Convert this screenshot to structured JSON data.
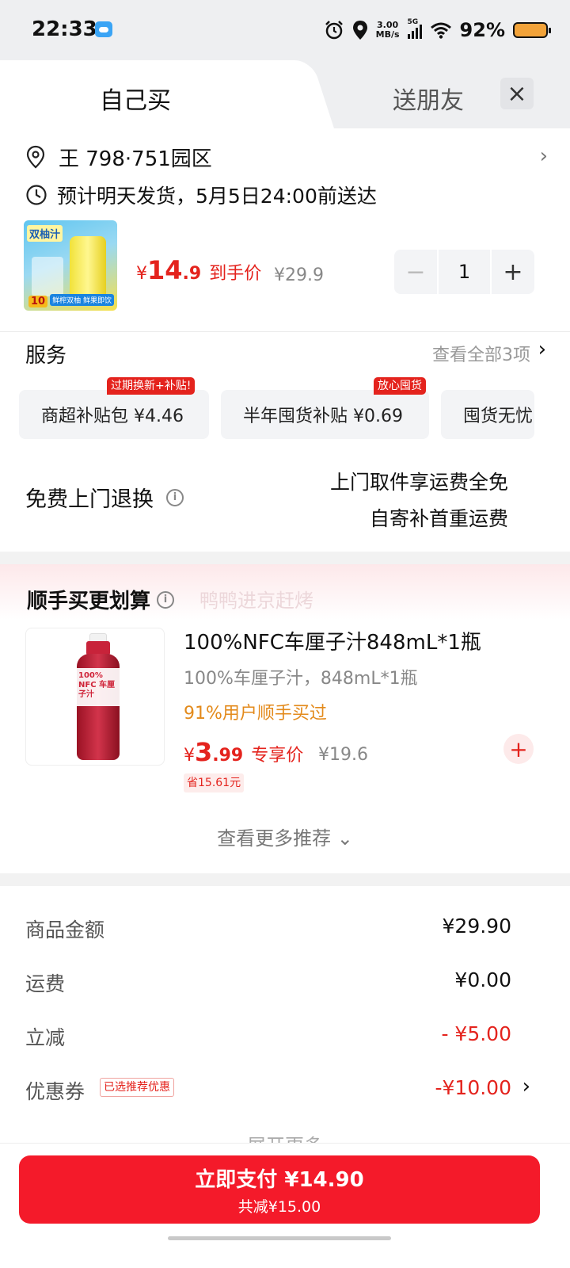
{
  "status_bar": {
    "time": "22:33",
    "net_speed_value": "3.00",
    "net_speed_unit": "MB/s",
    "network": "5G",
    "battery": "92%",
    "icons": [
      "weather-cloud-icon",
      "alarm-icon",
      "location-icon",
      "signal-icon",
      "wifi-icon",
      "battery-icon"
    ]
  },
  "tabs": {
    "self_buy": "自己买",
    "gift": "送朋友",
    "close_icon": "×"
  },
  "address": {
    "text": "王  798·751园区",
    "chevron": "›"
  },
  "shipping": {
    "text": "预计明天发货，5月5日24:00前送达"
  },
  "product": {
    "image_title": "双柚汁",
    "image_badge": "10",
    "image_tag": "鲜榨双柚 鲜果即饮",
    "price_currency": "¥",
    "price_int": "14",
    "price_dec": ".9",
    "price_label": "到手价",
    "original_price": "¥29.9",
    "quantity": "1",
    "minus": "−",
    "plus": "+"
  },
  "service": {
    "title": "服务",
    "view_all": "查看全部3项",
    "chevron": "›",
    "cards": [
      {
        "label": "商超补贴包  ¥4.46",
        "badge": "过期换新+补贴!"
      },
      {
        "label": "半年囤货补贴  ¥0.69",
        "badge": "放心囤货"
      },
      {
        "label": "囤货无忧",
        "badge": ""
      }
    ]
  },
  "free_return": {
    "label": "免费上门退换",
    "info_icon": "i",
    "note_line1": "上门取件享运费全免",
    "note_line2": "自寄补首重运费"
  },
  "recommend": {
    "title": "顺手买更划算",
    "info_icon": "i",
    "watermark": "鸭鸭进京赶烤",
    "item": {
      "bottle_text": "100% NFC 车厘子汁",
      "name": "100%NFC车厘子汁848mL*1瓶",
      "spec": "100%车厘子汁，848mL*1瓶",
      "bought": "91%用户顺手买过",
      "price_currency": "¥",
      "price_int": "3",
      "price_dec": ".99",
      "price_label": "专享价",
      "original_price": "¥19.6",
      "save": "省15.61元",
      "add": "+"
    },
    "view_more": "查看更多推荐 ⌄"
  },
  "summary": {
    "goods_label": "商品金额",
    "goods_value": "¥29.90",
    "freight_label": "运费",
    "freight_value": "¥0.00",
    "discount_label": "立减",
    "discount_value": "- ¥5.00",
    "coupon_label": "优惠券",
    "coupon_tag": "已选推荐优惠",
    "coupon_value": "-¥10.00",
    "coupon_chevron": "›",
    "expand": "展开更多"
  },
  "pay": {
    "main": "立即支付 ¥14.90",
    "sub": "共减¥15.00"
  },
  "colors": {
    "accent_red": "#e4231d",
    "pay_button": "#f41a2a",
    "orange": "#e38a1b"
  }
}
